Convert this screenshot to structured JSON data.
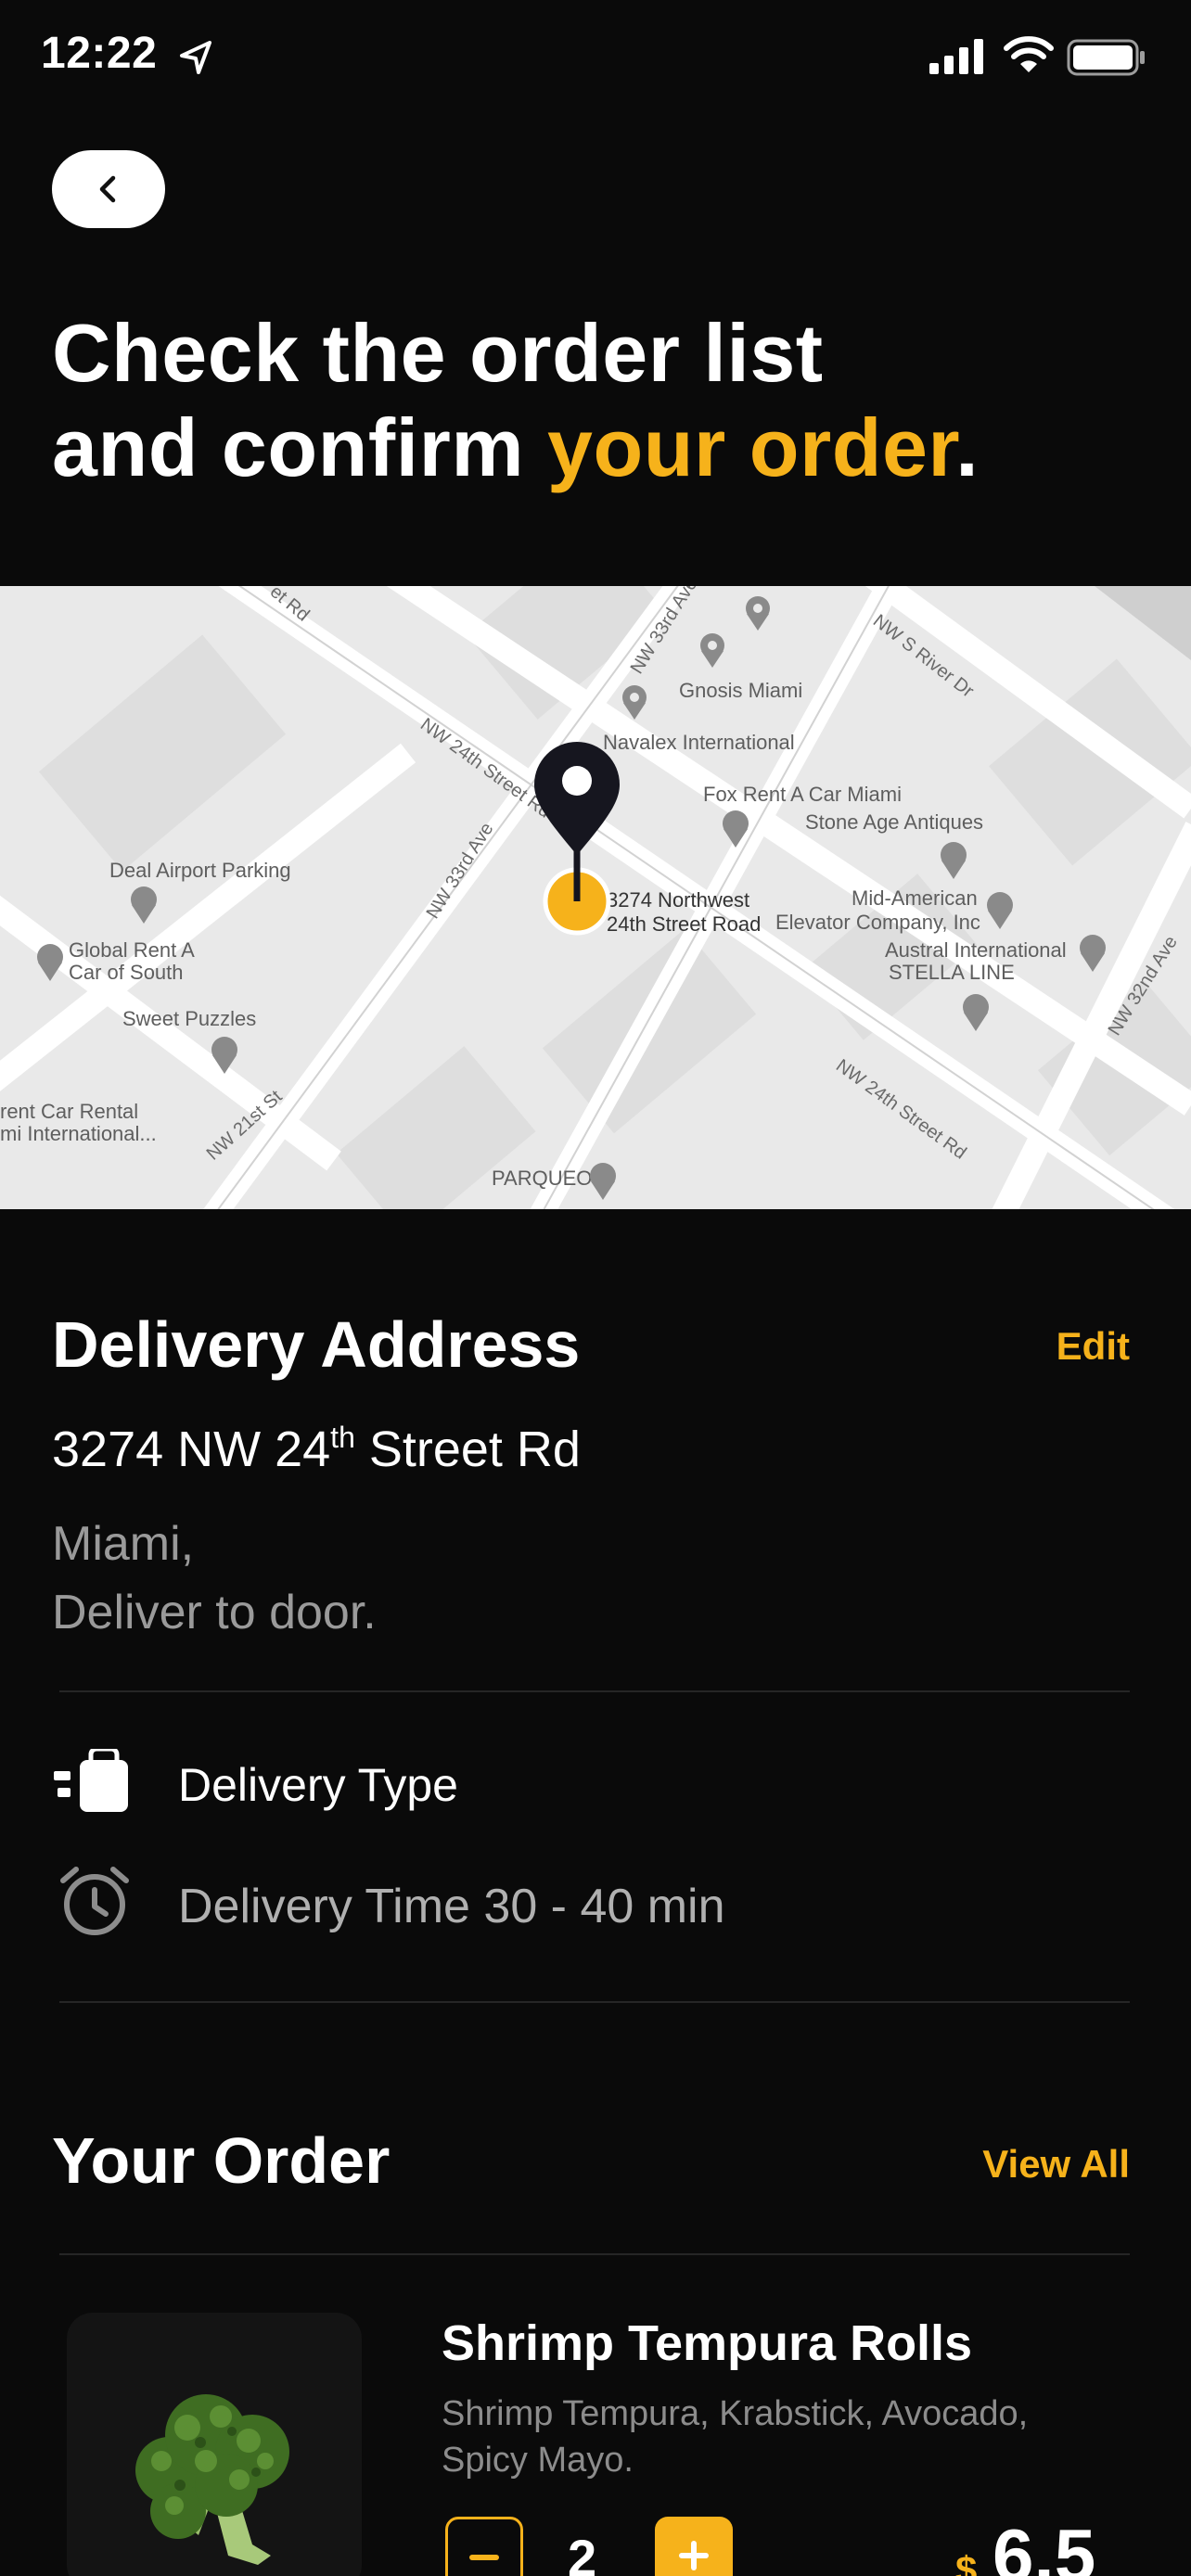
{
  "status_bar": {
    "time": "12:22"
  },
  "header": {
    "headline_line1": "Check the order list",
    "headline_line2_prefix": "and confirm ",
    "headline_accent": "your order",
    "headline_suffix": "."
  },
  "map": {
    "streets": [
      "NW 33rd Ave",
      "NW S River Dr",
      "NW 24th Street Rd",
      "NW 33rd Ave",
      "NW 21st St",
      "NW 24th Street Rd",
      "NW 32nd Ave",
      "et Rd"
    ],
    "places": [
      "Gnosis Miami",
      "Navalex International",
      "Fox Rent A Car Miami",
      "Stone Age Antiques",
      "Deal Airport Parking",
      "3274 Northwest",
      "24th Street Road",
      "Mid-American",
      "Elevator Company, Inc",
      "Global Rent A",
      "Car of South",
      "Austral International",
      "STELLA LINE",
      "Sweet Puzzles",
      "rent Car Rental",
      "mi International...",
      "PARQUEO"
    ]
  },
  "delivery": {
    "title": "Delivery Address",
    "edit_label": "Edit",
    "street_pre": "3274 NW 24",
    "street_sup": "th",
    "street_post": " Street Rd",
    "city": "Miami,",
    "note": "Deliver to door.",
    "type_label": "Delivery Type",
    "time_label": "Delivery Time 30 - 40 min"
  },
  "order": {
    "title": "Your Order",
    "view_all_label": "View All",
    "items": [
      {
        "name": "Shrimp Tempura Rolls",
        "description": "Shrimp Tempura, Krabstick, Avocado, Spicy Mayo.",
        "quantity": "2",
        "currency": "$",
        "price": "6.5"
      }
    ]
  },
  "colors": {
    "accent": "#f6b21b",
    "background": "#0a0a0a",
    "muted": "#9a9a9a"
  }
}
